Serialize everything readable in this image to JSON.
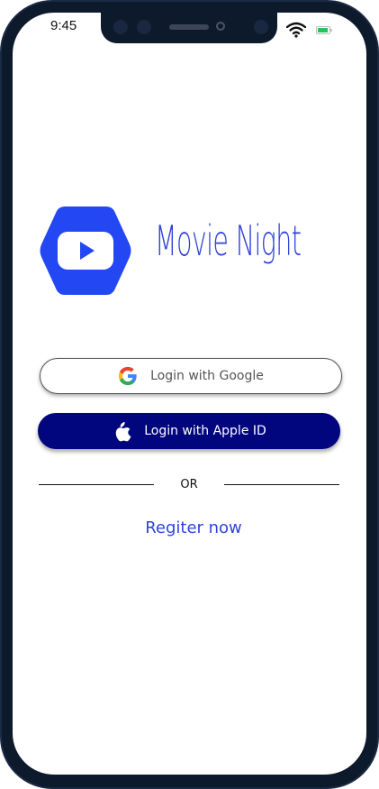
{
  "status_bar": {
    "time": "9:45",
    "wifi_icon": "wifi-icon",
    "battery_icon": "battery-icon",
    "battery_color": "#22c55e"
  },
  "brand": {
    "logo_icon": "play-hexagon-icon",
    "app_name": "Movie Night",
    "accent_color": "#2f44d6"
  },
  "login": {
    "google_label": "Login with Google",
    "google_icon": "google-icon",
    "apple_label": "Login with Apple ID",
    "apple_icon": "apple-icon",
    "apple_button_color": "#01057e"
  },
  "divider": {
    "text": "OR"
  },
  "register": {
    "label": "Regiter now"
  }
}
